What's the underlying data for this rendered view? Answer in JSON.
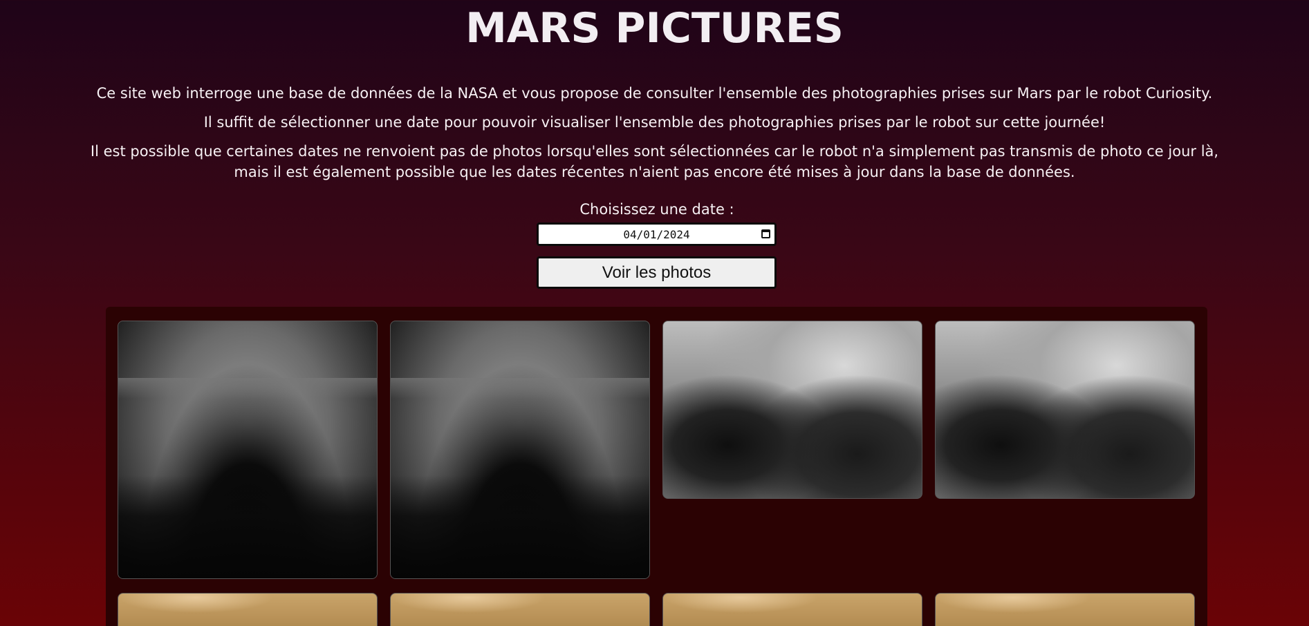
{
  "header": {
    "title": "MARS PICTURES"
  },
  "intro": {
    "paragraph_1": "Ce site web interroge une base de données de la NASA et vous propose de consulter l'ensemble des photographies prises sur Mars par le robot Curiosity.",
    "paragraph_2": "Il suffit de sélectionner une date pour pouvoir visualiser l'ensemble des photographies prises par le robot sur cette journée!",
    "paragraph_3": "Il est possible que certaines dates ne renvoient pas de photos lorsqu'elles sont sélectionnées car le robot n'a simplement pas transmis de photo ce jour là, mais il est également possible que les dates récentes n'aient pas encore été mises à jour dans la base de données."
  },
  "form": {
    "date_label": "Choisissez une date :",
    "date_value": "04/01/2024",
    "submit_label": "Voir les photos"
  },
  "gallery": {
    "photos": [
      {
        "kind": "fisheye"
      },
      {
        "kind": "fisheye"
      },
      {
        "kind": "hazcam"
      },
      {
        "kind": "hazcam"
      },
      {
        "kind": "color"
      },
      {
        "kind": "color"
      },
      {
        "kind": "color"
      },
      {
        "kind": "color"
      }
    ]
  },
  "colors": {
    "background_top": "#1f0418",
    "background_bottom": "#6a0306",
    "gallery_bg": "#2b0203",
    "text": "#f3eef2",
    "button_bg": "#efefef"
  }
}
